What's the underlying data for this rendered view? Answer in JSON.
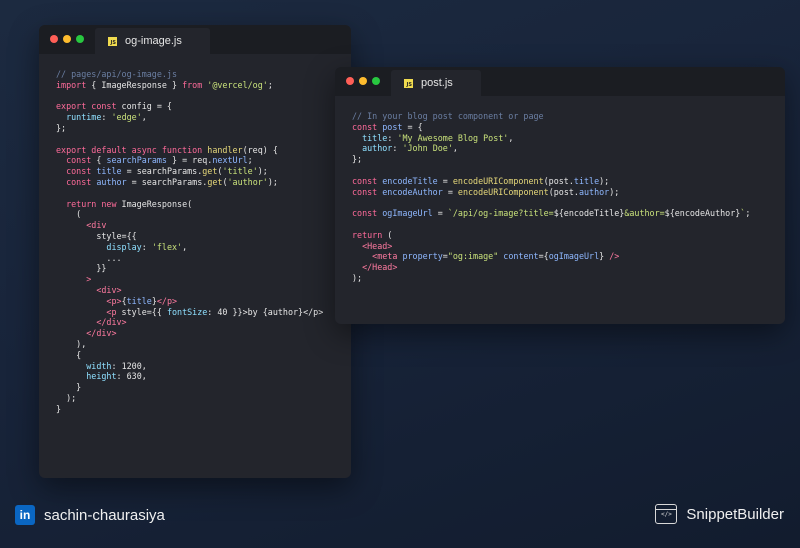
{
  "windows": [
    {
      "tab_label": "og-image.js",
      "tab_icon": "js-file-icon",
      "lines": [
        [
          [
            "c-comment",
            "// pages/api/og-image.js"
          ]
        ],
        [
          [
            "c-kw",
            "import"
          ],
          [
            "c-plain",
            " { ImageResponse } "
          ],
          [
            "c-kw",
            "from"
          ],
          [
            "c-plain",
            " "
          ],
          [
            "c-str",
            "'@vercel/og'"
          ],
          [
            "c-plain",
            ";"
          ]
        ],
        [],
        [
          [
            "c-kw",
            "export const"
          ],
          [
            "c-plain",
            " config = {"
          ]
        ],
        [
          [
            "c-plain",
            "  "
          ],
          [
            "c-prop",
            "runtime"
          ],
          [
            "c-plain",
            ": "
          ],
          [
            "c-str",
            "'edge'"
          ],
          [
            "c-plain",
            ","
          ]
        ],
        [
          [
            "c-plain",
            "};"
          ]
        ],
        [],
        [
          [
            "c-kw",
            "export default async function"
          ],
          [
            "c-plain",
            " "
          ],
          [
            "c-fn",
            "handler"
          ],
          [
            "c-plain",
            "(req) {"
          ]
        ],
        [
          [
            "c-plain",
            "  "
          ],
          [
            "c-kw",
            "const"
          ],
          [
            "c-plain",
            " { "
          ],
          [
            "c-var",
            "searchParams"
          ],
          [
            "c-plain",
            " } = req."
          ],
          [
            "c-var",
            "nextUrl"
          ],
          [
            "c-plain",
            ";"
          ]
        ],
        [
          [
            "c-plain",
            "  "
          ],
          [
            "c-kw",
            "const"
          ],
          [
            "c-plain",
            " "
          ],
          [
            "c-var",
            "title"
          ],
          [
            "c-plain",
            " = searchParams."
          ],
          [
            "c-fn",
            "get"
          ],
          [
            "c-plain",
            "("
          ],
          [
            "c-str",
            "'title'"
          ],
          [
            "c-plain",
            ");"
          ]
        ],
        [
          [
            "c-plain",
            "  "
          ],
          [
            "c-kw",
            "const"
          ],
          [
            "c-plain",
            " "
          ],
          [
            "c-var",
            "author"
          ],
          [
            "c-plain",
            " = searchParams."
          ],
          [
            "c-fn",
            "get"
          ],
          [
            "c-plain",
            "("
          ],
          [
            "c-str",
            "'author'"
          ],
          [
            "c-plain",
            ");"
          ]
        ],
        [],
        [
          [
            "c-plain",
            "  "
          ],
          [
            "c-kw",
            "return new"
          ],
          [
            "c-plain",
            " ImageResponse("
          ]
        ],
        [
          [
            "c-plain",
            "    ("
          ]
        ],
        [
          [
            "c-plain",
            "      "
          ],
          [
            "c-tag",
            "<div"
          ]
        ],
        [
          [
            "c-plain",
            "        style={{"
          ]
        ],
        [
          [
            "c-plain",
            "          "
          ],
          [
            "c-prop",
            "display"
          ],
          [
            "c-plain",
            ": "
          ],
          [
            "c-str",
            "'flex'"
          ],
          [
            "c-plain",
            ","
          ]
        ],
        [
          [
            "c-plain",
            "          ..."
          ]
        ],
        [
          [
            "c-plain",
            "        }}"
          ]
        ],
        [
          [
            "c-plain",
            "      "
          ],
          [
            "c-tag",
            ">"
          ]
        ],
        [
          [
            "c-plain",
            "        "
          ],
          [
            "c-tag",
            "<div>"
          ]
        ],
        [
          [
            "c-plain",
            "          "
          ],
          [
            "c-tag",
            "<p>"
          ],
          [
            "c-plain",
            "{"
          ],
          [
            "c-var",
            "title"
          ],
          [
            "c-plain",
            "}"
          ],
          [
            "c-tag",
            "</p>"
          ]
        ],
        [
          [
            "c-plain",
            "          "
          ],
          [
            "c-tag",
            "<p"
          ],
          [
            "c-plain",
            " style={{ "
          ],
          [
            "c-prop",
            "fontSize"
          ],
          [
            "c-plain",
            ": 40 }}>by {author}</p>"
          ]
        ],
        [
          [
            "c-plain",
            "        "
          ],
          [
            "c-tag",
            "</div>"
          ]
        ],
        [
          [
            "c-plain",
            "      "
          ],
          [
            "c-tag",
            "</div>"
          ]
        ],
        [
          [
            "c-plain",
            "    ),"
          ]
        ],
        [
          [
            "c-plain",
            "    {"
          ]
        ],
        [
          [
            "c-plain",
            "      "
          ],
          [
            "c-prop",
            "width"
          ],
          [
            "c-plain",
            ": 1200,"
          ]
        ],
        [
          [
            "c-plain",
            "      "
          ],
          [
            "c-prop",
            "height"
          ],
          [
            "c-plain",
            ": 630,"
          ]
        ],
        [
          [
            "c-plain",
            "    }"
          ]
        ],
        [
          [
            "c-plain",
            "  );"
          ]
        ],
        [
          [
            "c-plain",
            "}"
          ]
        ]
      ]
    },
    {
      "tab_label": "post.js",
      "tab_icon": "js-file-icon",
      "lines": [
        [
          [
            "c-comment",
            "// In your blog post component or page"
          ]
        ],
        [
          [
            "c-kw",
            "const"
          ],
          [
            "c-plain",
            " "
          ],
          [
            "c-var",
            "post"
          ],
          [
            "c-plain",
            " = {"
          ]
        ],
        [
          [
            "c-plain",
            "  "
          ],
          [
            "c-prop",
            "title"
          ],
          [
            "c-plain",
            ": "
          ],
          [
            "c-str",
            "'My Awesome Blog Post'"
          ],
          [
            "c-plain",
            ","
          ]
        ],
        [
          [
            "c-plain",
            "  "
          ],
          [
            "c-prop",
            "author"
          ],
          [
            "c-plain",
            ": "
          ],
          [
            "c-str",
            "'John Doe'"
          ],
          [
            "c-plain",
            ","
          ]
        ],
        [
          [
            "c-plain",
            "};"
          ]
        ],
        [],
        [
          [
            "c-kw",
            "const"
          ],
          [
            "c-plain",
            " "
          ],
          [
            "c-var",
            "encodeTitle"
          ],
          [
            "c-plain",
            " = "
          ],
          [
            "c-fn",
            "encodeURIComponent"
          ],
          [
            "c-plain",
            "(post."
          ],
          [
            "c-var",
            "title"
          ],
          [
            "c-plain",
            ");"
          ]
        ],
        [
          [
            "c-kw",
            "const"
          ],
          [
            "c-plain",
            " "
          ],
          [
            "c-var",
            "encodeAuthor"
          ],
          [
            "c-plain",
            " = "
          ],
          [
            "c-fn",
            "encodeURIComponent"
          ],
          [
            "c-plain",
            "(post."
          ],
          [
            "c-var",
            "author"
          ],
          [
            "c-plain",
            ");"
          ]
        ],
        [],
        [
          [
            "c-kw",
            "const"
          ],
          [
            "c-plain",
            " "
          ],
          [
            "c-var",
            "ogImageUrl"
          ],
          [
            "c-plain",
            " = "
          ],
          [
            "c-str",
            "`/api/og-image?title="
          ],
          [
            "c-plain",
            "${encodeTitle}"
          ],
          [
            "c-str",
            "&author="
          ],
          [
            "c-plain",
            "${encodeAuthor}"
          ],
          [
            "c-str",
            "`"
          ],
          [
            "c-plain",
            ";"
          ]
        ],
        [],
        [
          [
            "c-kw",
            "return"
          ],
          [
            "c-plain",
            " ("
          ]
        ],
        [
          [
            "c-plain",
            "  "
          ],
          [
            "c-tag",
            "<Head>"
          ]
        ],
        [
          [
            "c-plain",
            "    "
          ],
          [
            "c-tag",
            "<meta"
          ],
          [
            "c-plain",
            " "
          ],
          [
            "c-var",
            "property"
          ],
          [
            "c-plain",
            "="
          ],
          [
            "c-str",
            "\"og:image\""
          ],
          [
            "c-plain",
            " "
          ],
          [
            "c-var",
            "content"
          ],
          [
            "c-plain",
            "={"
          ],
          [
            "c-var",
            "ogImageUrl"
          ],
          [
            "c-plain",
            "} "
          ],
          [
            "c-tag",
            "/>"
          ]
        ],
        [
          [
            "c-plain",
            "  "
          ],
          [
            "c-tag",
            "</Head>"
          ]
        ],
        [
          [
            "c-plain",
            ");"
          ]
        ]
      ]
    }
  ],
  "footer": {
    "author": "sachin-chaurasiya",
    "author_icon": "linkedin-icon",
    "brand": "SnippetBuilder",
    "brand_icon": "snippetbuilder-logo-icon",
    "linkedin_glyph": "in",
    "brand_glyph": "</>"
  },
  "colors": {
    "background": "#18243a",
    "window": "#23252c",
    "titlebar": "#1b1d22",
    "keyword": "#ff6b9a",
    "string": "#c9e27b",
    "comment": "#6b7fa3",
    "linkedin": "#0a66c2"
  }
}
